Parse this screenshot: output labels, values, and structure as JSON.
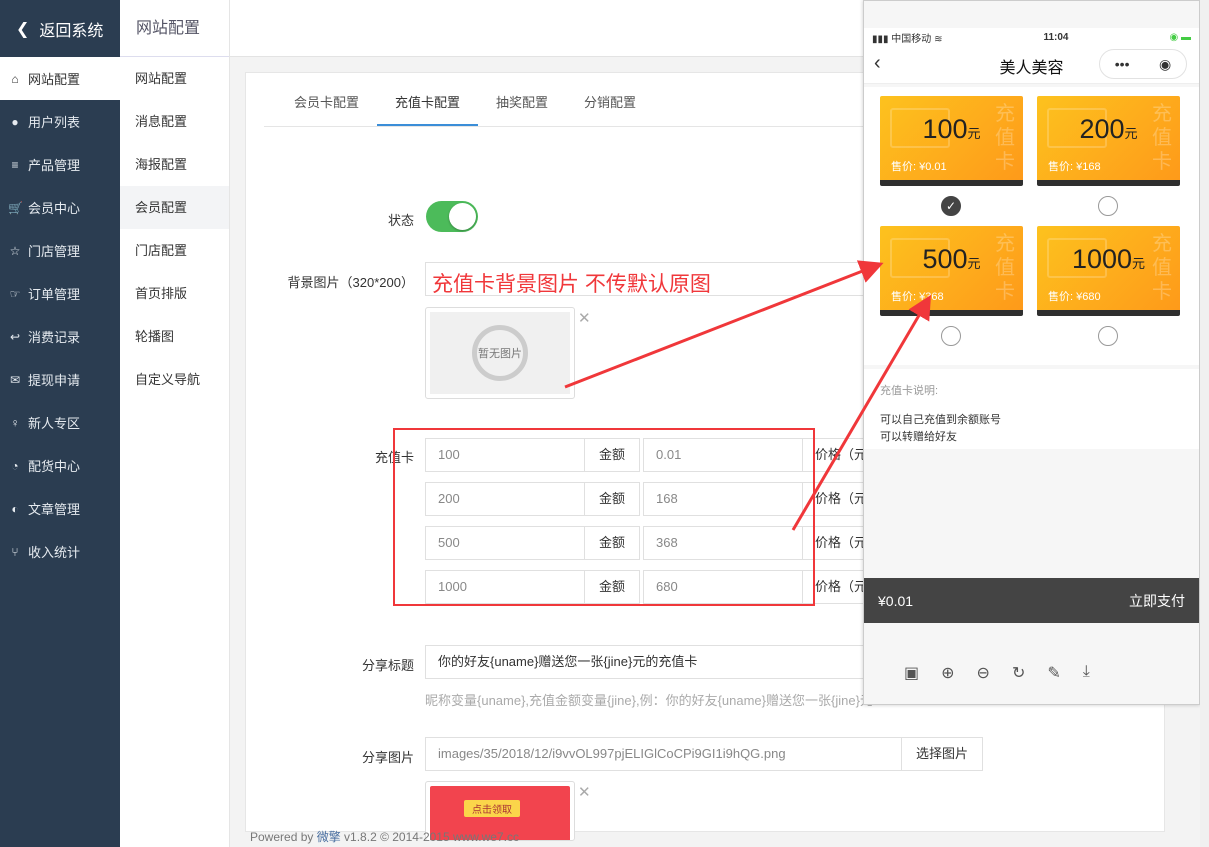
{
  "sidebar": {
    "back": "返回系统",
    "items": [
      {
        "icon": "home-icon",
        "glyph": "⌂",
        "label": "网站配置"
      },
      {
        "icon": "user-icon",
        "glyph": "●",
        "label": "用户列表"
      },
      {
        "icon": "server-icon",
        "glyph": "≡",
        "label": "产品管理"
      },
      {
        "icon": "cart-icon",
        "glyph": "🛒",
        "label": "会员中心"
      },
      {
        "icon": "star-icon",
        "glyph": "☆",
        "label": "门店管理"
      },
      {
        "icon": "hand-point-icon",
        "glyph": "☞",
        "label": "订单管理"
      },
      {
        "icon": "reply-icon",
        "glyph": "↩",
        "label": "消费记录"
      },
      {
        "icon": "wechat-icon",
        "glyph": "✉",
        "label": "提现申请"
      },
      {
        "icon": "map-pin-icon",
        "glyph": "♀",
        "label": "新人专区"
      },
      {
        "icon": "pie-chart-icon",
        "glyph": "◔",
        "label": "配货中心"
      },
      {
        "icon": "adjust-icon",
        "glyph": "◐",
        "label": "文章管理"
      },
      {
        "icon": "branch-icon",
        "glyph": "⑂",
        "label": "收入统计"
      }
    ]
  },
  "subnav": {
    "title": "网站配置",
    "items": [
      "网站配置",
      "消息配置",
      "海报配置",
      "会员配置",
      "门店配置",
      "首页排版",
      "轮播图",
      "自定义导航"
    ]
  },
  "tabs": [
    "会员卡配置",
    "充值卡配置",
    "抽奖配置",
    "分销配置"
  ],
  "form": {
    "status_label": "状态",
    "bg_label": "背景图片（320*200）",
    "no_image": "暂无图片",
    "card_label": "充值卡",
    "amount_addon": "金额",
    "price_addon": "价格（元）",
    "cards": [
      {
        "amount": "100",
        "price": "0.01"
      },
      {
        "amount": "200",
        "price": "168"
      },
      {
        "amount": "500",
        "price": "368"
      },
      {
        "amount": "1000",
        "price": "680"
      }
    ],
    "share_title_label": "分享标题",
    "share_title": "你的好友{uname}赠送您一张{jine}元的充值卡",
    "share_hint": "昵称变量{uname},充值金额变量{jine},例：你的好友{uname}赠送您一张{jine}元",
    "share_img_label": "分享图片",
    "share_img": "images/35/2018/12/i9vvOL997pjELIGlCoCPi9GI1i9hQG.png",
    "select_img": "选择图片",
    "share_img_btn": "点击领取"
  },
  "annotation": "充值卡背景图片 不传默认原图",
  "footer": {
    "pre": "Powered by ",
    "brand": "微擎",
    "post": " v1.8.2 © 2014-2015 www.we7.cc"
  },
  "phone": {
    "carrier": "中国移动",
    "time": "11:04",
    "title": "美人美容",
    "cards": [
      {
        "amount": "100",
        "unit": "元",
        "price": "售价: ¥0.01",
        "selected": true
      },
      {
        "amount": "200",
        "unit": "元",
        "price": "售价: ¥168"
      },
      {
        "amount": "500",
        "unit": "元",
        "price": "售价: ¥368"
      },
      {
        "amount": "1000",
        "unit": "元",
        "price": "售价: ¥680"
      }
    ],
    "watermark": "充值卡",
    "desc_title": "充值卡说明:",
    "desc": [
      "可以自己充值到余额账号",
      "可以转赠给好友"
    ],
    "total": "¥0.01",
    "pay": "立即支付"
  },
  "colors": {
    "sidebar": "#2b3d51",
    "accent": "#3b8ed8",
    "annotation": "#f0373a",
    "toggle": "#4cbb5a"
  }
}
